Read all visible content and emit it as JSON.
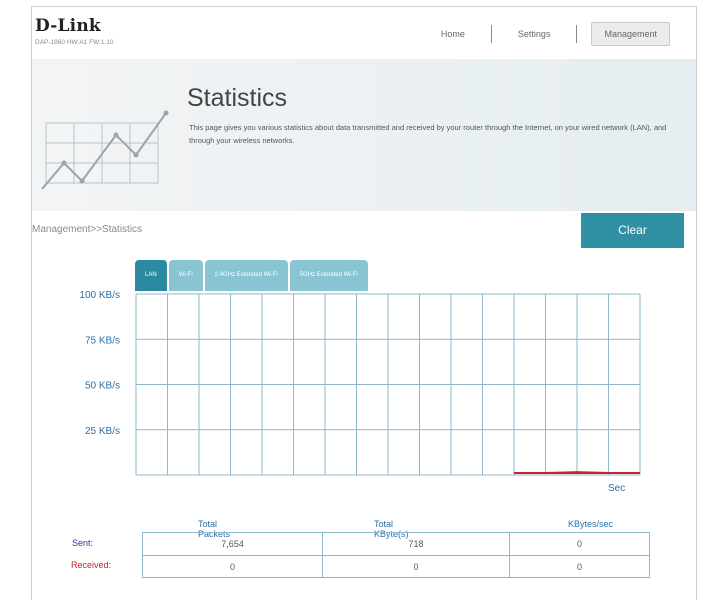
{
  "header": {
    "brand": "D-Link",
    "model": "DAP-1860 HW:A1 FW:1.10",
    "nav": [
      {
        "label": "Home"
      },
      {
        "label": "Settings"
      },
      {
        "label": "Management"
      }
    ]
  },
  "banner": {
    "title": "Statistics",
    "description": "This page gives you various statistics about data transmitted and received by your router through the Internet, on your wired network (LAN), and through your wireless networks."
  },
  "breadcrumb": "Management>>Statistics",
  "clear_label": "Clear",
  "tabs": [
    "LAN",
    "Wi-Fi",
    "2.4GHz Extended Wi-Fi",
    "5GHz Extended Wi-Fi"
  ],
  "active_tab": "LAN",
  "colors": {
    "accent": "#2f8fa3",
    "tab_inactive": "#88c4d2",
    "sent": "#2a3a9a",
    "received": "#d0202a",
    "grid": "#8fb8cc"
  },
  "chart_data": {
    "type": "line",
    "y_ticks": [
      "100 KB/s",
      "75 KB/s",
      "50 KB/s",
      "25 KB/s"
    ],
    "ylim": [
      0,
      100
    ],
    "x_unit": "Sec",
    "grid": true,
    "series": [
      {
        "name": "Sent",
        "color": "#2a3a9a",
        "values": [
          0,
          0,
          0.4,
          0,
          0
        ]
      },
      {
        "name": "Received",
        "color": "#d0202a",
        "values": [
          0,
          0,
          0,
          0,
          0
        ]
      }
    ]
  },
  "stats": {
    "headers": [
      "Total Packets",
      "Total KByte(s)",
      "KBytes/sec"
    ],
    "rows": [
      {
        "label": "Sent:",
        "color": "#2a3a9a",
        "values": [
          "7,654",
          "718",
          "0"
        ]
      },
      {
        "label": "Received:",
        "color": "#d0202a",
        "values": [
          "0",
          "0",
          "0"
        ]
      }
    ]
  }
}
